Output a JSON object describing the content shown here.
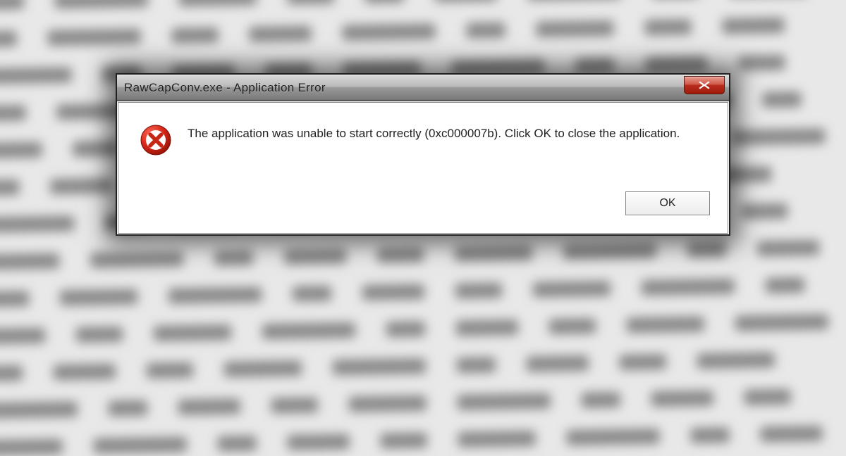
{
  "dialog": {
    "title": "RawCapConv.exe - Application Error",
    "message": "The application was unable to start correctly (0xc000007b). Click OK to close the application.",
    "ok_label": "OK"
  }
}
